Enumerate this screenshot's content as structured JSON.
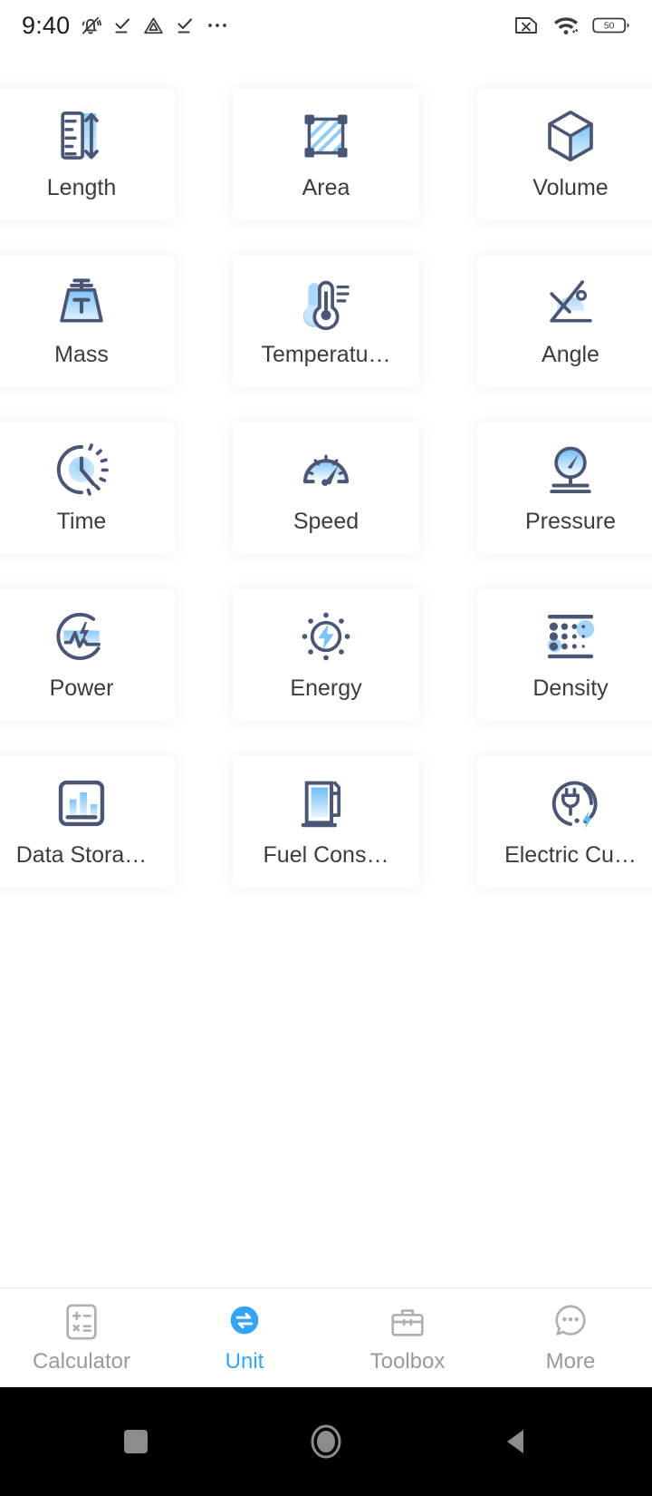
{
  "status_bar": {
    "time": "9:40",
    "left_icons": [
      "mute-bell-icon",
      "download-check-icon",
      "triangle-alert-icon",
      "download-check-icon",
      "more-dots-icon"
    ],
    "right_icons": [
      "no-sim-icon",
      "wifi-icon",
      "battery-icon"
    ],
    "battery_level": "50"
  },
  "colors": {
    "accent": "#36a4f4",
    "icon_dark": "#4a5674",
    "icon_blue_light": "#b9def8",
    "icon_blue": "#63b8f5",
    "label": "#3c3c3c",
    "nav_inactive": "#9a9a9a",
    "background": "#ffffff"
  },
  "grid": {
    "tiles": [
      {
        "label": "Length",
        "icon": "ruler-arrow-icon"
      },
      {
        "label": "Area",
        "icon": "square-hatched-icon"
      },
      {
        "label": "Volume",
        "icon": "cube-icon"
      },
      {
        "label": "Mass",
        "icon": "weight-icon"
      },
      {
        "label": "Temperatu…",
        "icon": "thermometer-icon"
      },
      {
        "label": "Angle",
        "icon": "angle-protractor-icon"
      },
      {
        "label": "Time",
        "icon": "clock-dashed-icon"
      },
      {
        "label": "Speed",
        "icon": "speedometer-icon"
      },
      {
        "label": "Pressure",
        "icon": "pressure-gauge-icon"
      },
      {
        "label": "Power",
        "icon": "power-wave-icon"
      },
      {
        "label": "Energy",
        "icon": "energy-sun-bolt-icon"
      },
      {
        "label": "Density",
        "icon": "density-dots-icon"
      },
      {
        "label": "Data Stora…",
        "icon": "data-storage-chart-icon"
      },
      {
        "label": "Fuel Cons…",
        "icon": "fuel-pump-icon"
      },
      {
        "label": "Electric Cu…",
        "icon": "electric-plug-icon"
      }
    ]
  },
  "bottom_nav": {
    "items": [
      {
        "label": "Calculator",
        "icon": "calculator-icon",
        "active": false
      },
      {
        "label": "Unit",
        "icon": "unit-convert-icon",
        "active": true
      },
      {
        "label": "Toolbox",
        "icon": "briefcase-icon",
        "active": false
      },
      {
        "label": "More",
        "icon": "more-dots-bubble-icon",
        "active": false
      }
    ]
  },
  "system_nav": {
    "buttons": [
      "recents-square-icon",
      "home-circle-icon",
      "back-triangle-icon"
    ]
  }
}
